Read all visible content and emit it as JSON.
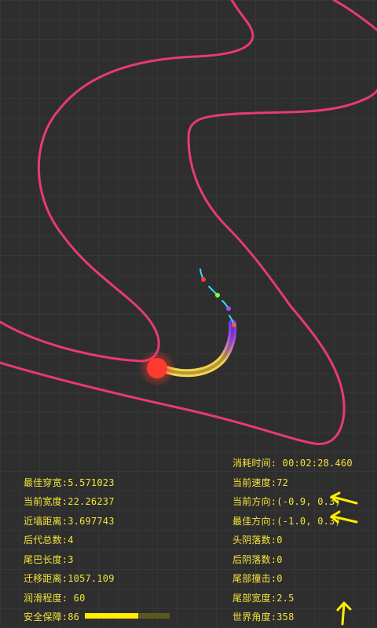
{
  "colors": {
    "background": "#2e2e2e",
    "track": "#e8397a",
    "hud_text": "#f5e43a",
    "head": "#ff3b30",
    "tail_start": "#ffe24a",
    "tail_end": "#7b3cff"
  },
  "left_stats": [
    {
      "id": "best-width",
      "text": "最佳穿宽:5.571023"
    },
    {
      "id": "current-width",
      "text": "当前宽度:22.26237"
    },
    {
      "id": "near-wall-distance",
      "text": "近墙距离:3.697743"
    },
    {
      "id": "generations",
      "text": "后代总数:4"
    },
    {
      "id": "tail-length",
      "text": "尾巴长度:3"
    },
    {
      "id": "migration-distance",
      "text": "迁移距离:1057.109"
    },
    {
      "id": "smoothness",
      "text": "润滑程度: 60"
    }
  ],
  "safety": {
    "label": "安全保障:86",
    "fill_fraction": 0.63
  },
  "right_stats": [
    {
      "id": "elapsed-time",
      "text": "消耗时间: 00:02:28.460"
    },
    {
      "id": "current-speed",
      "text": "当前速度:72"
    },
    {
      "id": "current-direction",
      "text": "当前方向:(-0.9, 0.3)",
      "arrow": "left-arrow-icon"
    },
    {
      "id": "best-direction",
      "text": "最佳方向:(-1.0, 0.3)",
      "arrow": "left-arrow-icon"
    },
    {
      "id": "head-collisions",
      "text": "头阴落数:0"
    },
    {
      "id": "rear-collisions",
      "text": "后阴落数:0"
    },
    {
      "id": "tail-hits",
      "text": "尾部撞击:0"
    },
    {
      "id": "tail-width",
      "text": "尾部宽度:2.5"
    },
    {
      "id": "world-angle",
      "text": "世界角度:358",
      "arrow": "up-arrow-icon"
    }
  ]
}
